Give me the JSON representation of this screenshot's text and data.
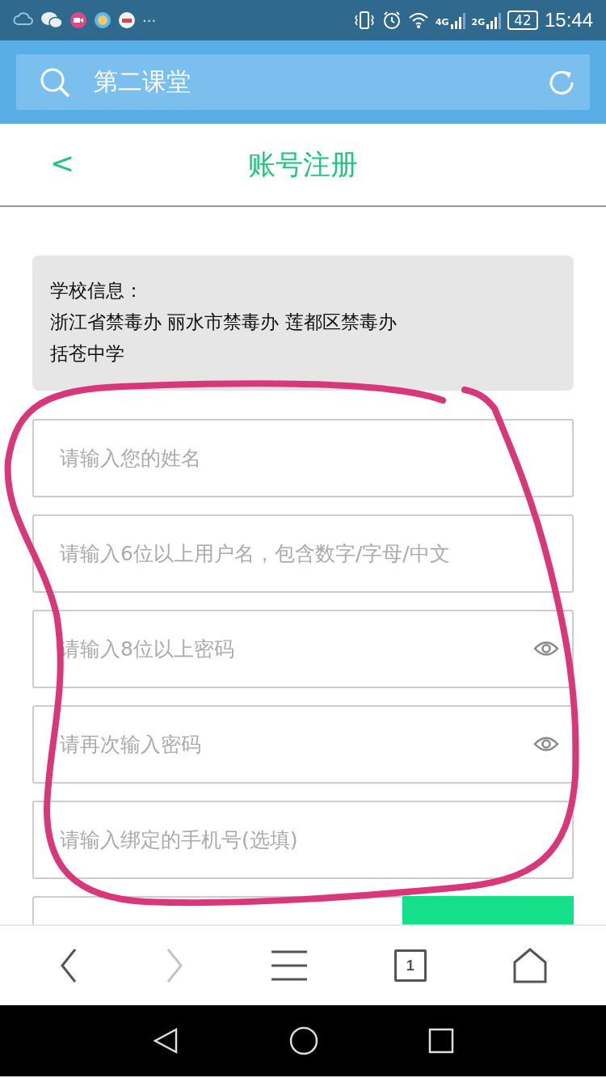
{
  "status_bar": {
    "more": "···",
    "network_1": "4G",
    "network_2": "2G",
    "battery": "42",
    "time": "15:44"
  },
  "search_bar": {
    "value": "第二课堂"
  },
  "header": {
    "back": "<",
    "title": "账号注册"
  },
  "school_info": {
    "label": "学校信息：",
    "lines": [
      "浙江省禁毒办 丽水市禁毒办 莲都区禁毒办",
      "括苍中学"
    ]
  },
  "fields": [
    {
      "kind": "text",
      "placeholder": "请输入您的姓名"
    },
    {
      "kind": "text",
      "placeholder": "请输入6位以上用户名，包含数字/字母/中文"
    },
    {
      "kind": "password",
      "placeholder": "请输入8位以上密码"
    },
    {
      "kind": "password",
      "placeholder": "请再次输入密码"
    },
    {
      "kind": "text",
      "placeholder": "请输入绑定的手机号(选填)"
    }
  ],
  "browser_nav": {
    "tab_count": "1"
  }
}
